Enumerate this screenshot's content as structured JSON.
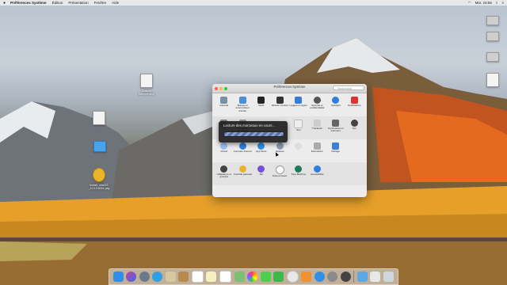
{
  "menubar": {
    "apple": "",
    "app": "Préférences Système",
    "items": [
      "Édition",
      "Présentation",
      "Fenêtre",
      "Aide"
    ],
    "clock": "Mar. 16:56"
  },
  "desktop_icons": [
    {
      "name": "Dossier Décrypt.dmg",
      "label": "Dossier\nDécrypt.dmg"
    },
    {
      "name": "document",
      "label": ""
    },
    {
      "name": "dossier",
      "label": ""
    },
    {
      "name": "Install macOS",
      "label": "Install_macOS\n_10.13.6001.pkg"
    },
    {
      "name": "disk-right-1",
      "label": ""
    },
    {
      "name": "disk-right-2",
      "label": ""
    },
    {
      "name": "disk-right-3",
      "label": ""
    }
  ],
  "window": {
    "title": "Préférences Système",
    "search_placeholder": "Rechercher",
    "row1": [
      "Général",
      "Bureau et économiseur d'écran",
      "Dock",
      "Mission Control",
      "Langue et région",
      "Sécurité et confidentialité",
      "Spotlight",
      "Notifications"
    ],
    "row2": [
      "",
      "",
      "",
      "",
      "Son",
      "Trackpad",
      "Imprimantes et scanners",
      "Son"
    ],
    "row2b": [
      "Into",
      "Disque de démarrage"
    ],
    "row3": [
      "iCloud",
      "Comptes Internet",
      "App Store",
      "Réseau",
      "",
      "Extensions",
      "Partage"
    ],
    "row4": [
      "Utilisateurs et groupes",
      "Contrôle parental",
      "Siri",
      "Date et heure",
      "Time Machine",
      "Accessibilité"
    ]
  },
  "loading": {
    "text": "Lecture des morceaux en cours…",
    "progress": 1.0
  },
  "dock": {
    "items": [
      "Finder",
      "Siri",
      "Launchpad",
      "Safari",
      "Mail",
      "Contacts",
      "Calendrier",
      "Notes",
      "Rappels",
      "Plans",
      "Photos",
      "Messages",
      "FaceTime",
      "iTunes",
      "iBooks",
      "App Store",
      "Préférences Système",
      "Utilitaire",
      "Dossier",
      "Téléchargements",
      "Corbeille"
    ]
  },
  "colors": {
    "accent": "#3b82f6",
    "close": "#ff5f57",
    "minimize": "#febc2e",
    "zoom": "#28c840"
  }
}
